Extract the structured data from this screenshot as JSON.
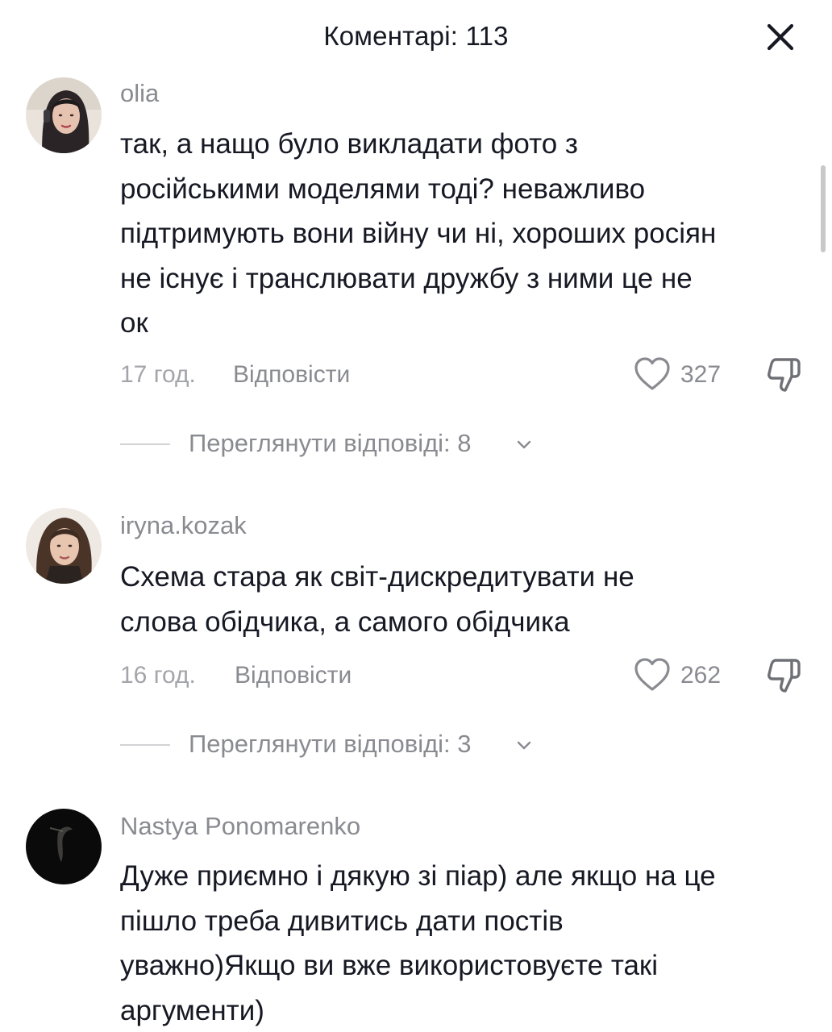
{
  "header": {
    "title": "Коментарі: 113"
  },
  "comments": [
    {
      "username": "olia",
      "text_lines": [
        "так, а нащо було викладати фото з",
        "російськими моделями тоді? неважливо",
        "підтримують вони війну чи ні, хороших росіян",
        "не існує і транслювати дружбу з ними це не",
        "ок"
      ],
      "time": "17 год.",
      "reply_label": "Відповісти",
      "likes": "327",
      "view_replies": "Переглянути відповіді: 8"
    },
    {
      "username": "iryna.kozak",
      "text_lines": [
        "Схема стара як світ-дискредитувати не",
        "слова обідчика, а самого обідчика"
      ],
      "time": "16 год.",
      "reply_label": "Відповісти",
      "likes": "262",
      "view_replies": "Переглянути відповіді: 3"
    },
    {
      "username": "Nastya Ponomarenko",
      "text_lines": [
        "Дуже приємно і дякую зі піар) але якщо на це",
        "пішло треба дивитись дати постів",
        "уважно)Якщо ви вже використовуєте такі",
        "аргументи)"
      ]
    }
  ],
  "icons": {
    "close": "close-icon",
    "like": "heart-outline-icon",
    "dislike": "thumbs-down-icon",
    "expand": "chevron-down-icon"
  },
  "colors": {
    "primary_text": "#161823",
    "secondary_text": "#8a8b91",
    "muted_text": "#a4a5aa",
    "background": "#ffffff"
  }
}
